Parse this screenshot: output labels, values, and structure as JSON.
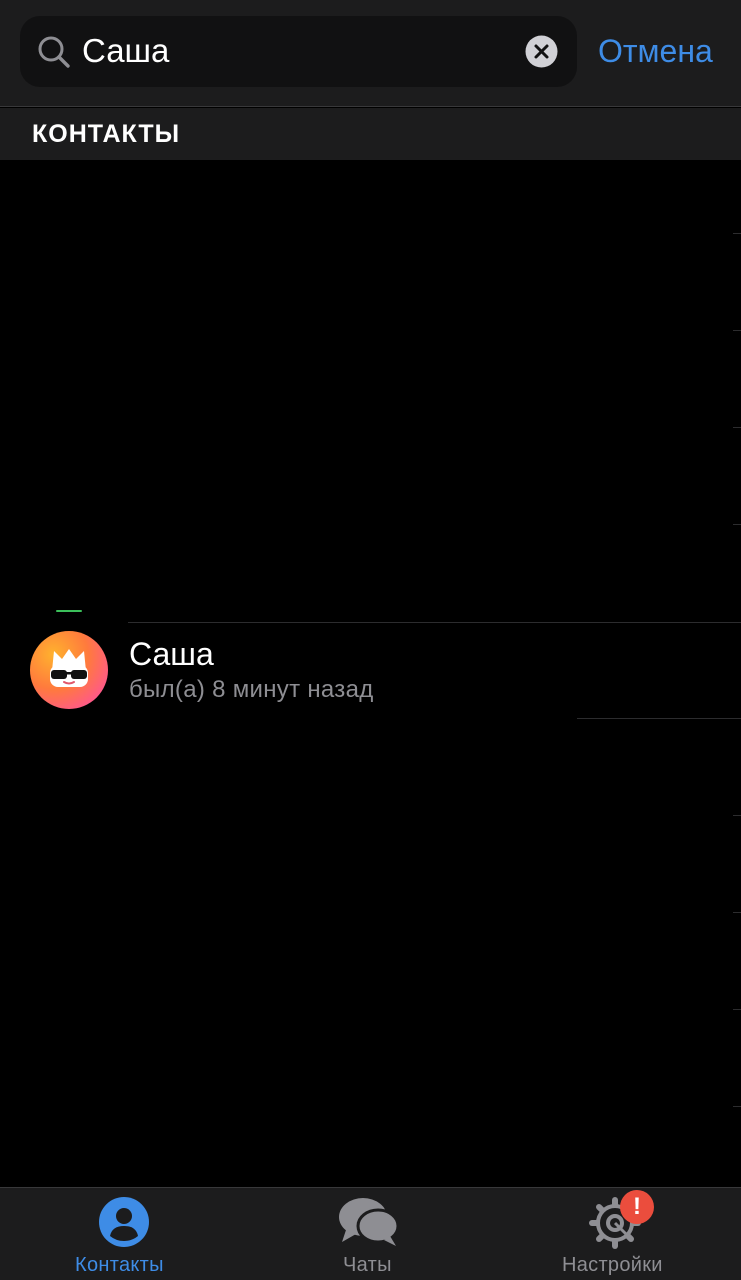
{
  "search": {
    "value": "Саша",
    "cancel_label": "Отмена"
  },
  "section": {
    "title": "КОНТАКТЫ"
  },
  "contacts": [
    {
      "name": "Саша",
      "status": "был(а) 8 минут назад",
      "avatar": "cool-cat-face-avatar"
    }
  ],
  "tabbar": {
    "tabs": [
      {
        "label": "Контакты",
        "icon": "person-circle-icon",
        "active": true
      },
      {
        "label": "Чаты",
        "icon": "chat-bubbles-icon",
        "active": false
      },
      {
        "label": "Настройки",
        "icon": "gear-icon",
        "active": false,
        "badge": "!"
      }
    ]
  },
  "colors": {
    "accent": "#3e8ce6",
    "background": "#000000",
    "bar_background": "#1c1c1d",
    "secondary_text": "#8e8e93",
    "badge": "#eb4d3d"
  }
}
